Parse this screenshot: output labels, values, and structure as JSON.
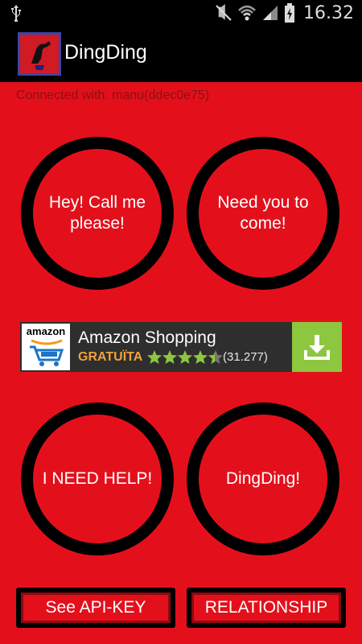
{
  "status_bar": {
    "time": "16.32",
    "icons": [
      "usb-icon",
      "mute-icon",
      "wifi-icon",
      "signal-icon",
      "battery-charging-icon"
    ]
  },
  "app_bar": {
    "title": "DingDing",
    "icon": "app-icon"
  },
  "connection": {
    "text": "Connected with: manu(ddec0e75)"
  },
  "actions": {
    "call_me_line1": "Hey! Call me",
    "call_me_line2": "please!",
    "come_line1": "Need you to",
    "come_line2": "come!",
    "help": "I NEED HELP!",
    "dingding": "DingDing!"
  },
  "ad": {
    "brand": "amazon",
    "title": "Amazon Shopping",
    "price_label": "GRATUÏTA",
    "rating_stars": 4.5,
    "rating_count": "(31.277)",
    "icon": "download-icon"
  },
  "bottom_buttons": {
    "api_key": "See API-KEY",
    "relationship": "RELATIONSHIP"
  },
  "colors": {
    "background": "#e3101c",
    "bars": "#000000",
    "ad_download": "#8dc63f"
  }
}
